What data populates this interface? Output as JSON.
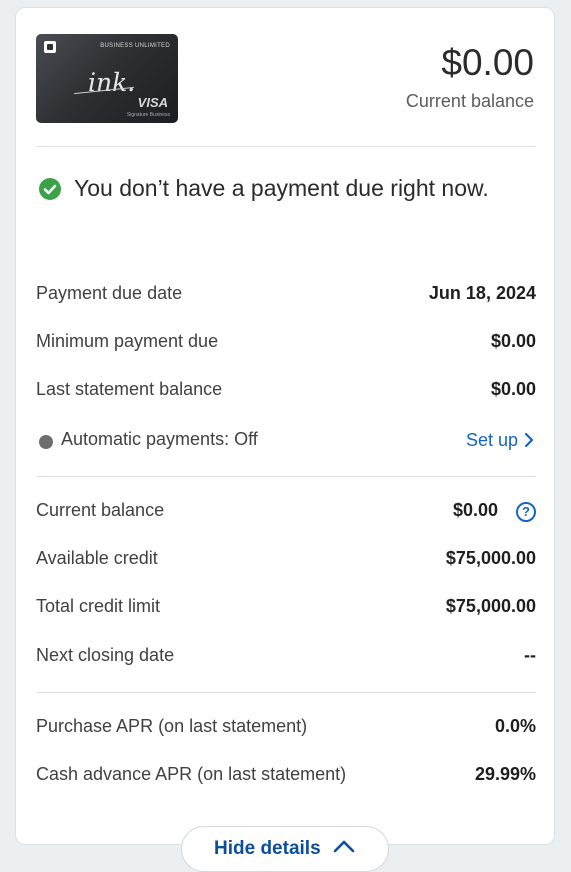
{
  "card": {
    "product_line": "BUSINESS UNLIMITED",
    "script_name": "ink.",
    "network": "VISA",
    "network_sub": "Signature Business"
  },
  "summary": {
    "balance_value": "$0.00",
    "balance_label": "Current balance"
  },
  "notice": {
    "icon": "check-circle-icon",
    "text": "You don’t have a payment due right now."
  },
  "payment_rows": [
    {
      "label": "Payment due date",
      "value": "Jun 18, 2024"
    },
    {
      "label": "Minimum payment due",
      "value": "$0.00"
    },
    {
      "label": "Last statement balance",
      "value": "$0.00"
    }
  ],
  "autopay": {
    "label": "Automatic payments: Off",
    "link": "Set up"
  },
  "credit_rows": {
    "current_balance": {
      "label": "Current balance",
      "value": "$0.00"
    },
    "available_credit": {
      "label": "Available credit",
      "value": "$75,000.00"
    },
    "total_credit_limit": {
      "label": "Total credit limit",
      "value": "$75,000.00"
    },
    "next_closing_date": {
      "label": "Next closing date",
      "value": "--"
    }
  },
  "apr_rows": [
    {
      "label": "Purchase APR (on last statement)",
      "value": "0.0%"
    },
    {
      "label": "Cash advance APR (on last statement)",
      "value": "29.99%"
    }
  ],
  "footer": {
    "hide_details_label": "Hide details"
  },
  "colors": {
    "link": "#1565c0",
    "success": "#3ca24a",
    "status_off": "#6e6e6e",
    "button_text": "#0b4e9e"
  }
}
